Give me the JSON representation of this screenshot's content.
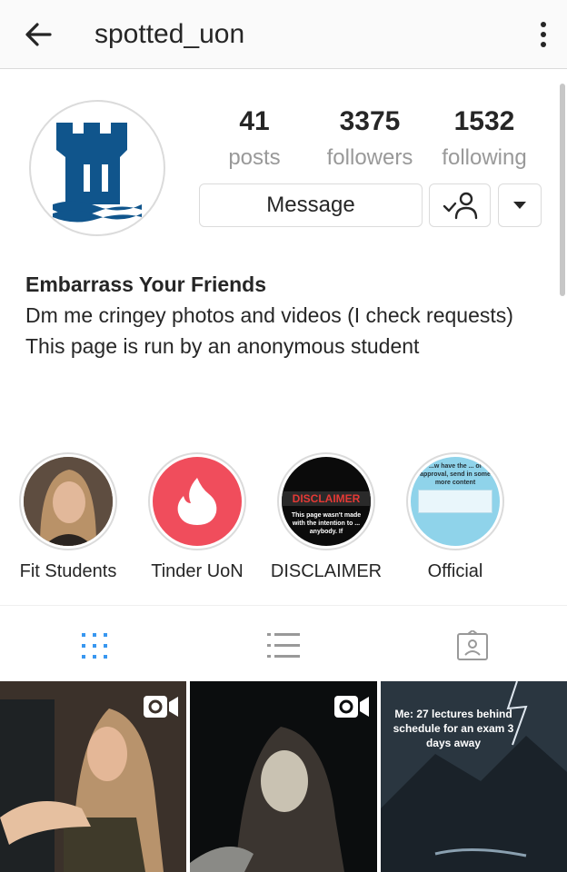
{
  "header": {
    "username": "spotted_uon"
  },
  "profile": {
    "stats": {
      "posts": {
        "value": "41",
        "label": "posts"
      },
      "followers": {
        "value": "3375",
        "label": "followers"
      },
      "following": {
        "value": "1532",
        "label": "following"
      }
    },
    "buttons": {
      "message": "Message"
    },
    "bio": {
      "name": "Embarrass Your Friends",
      "line1": "Dm me cringey photos and videos (I check requests)",
      "line2": "This page is run by an anonymous student"
    }
  },
  "highlights": [
    {
      "label": "Fit Students"
    },
    {
      "label": "Tinder UoN"
    },
    {
      "label": "DISCLAIMER",
      "thumb_title": "DISCLAIMER",
      "thumb_text": "This page wasn't made with the intention to ... anybody. If"
    },
    {
      "label": "Official",
      "thumb_text": "...w have the ... of approval, send in some more content"
    }
  ],
  "tabs": [
    {
      "icon": "grid-icon",
      "active": true
    },
    {
      "icon": "list-icon",
      "active": false
    },
    {
      "icon": "tagged-icon",
      "active": false
    }
  ],
  "posts": [
    {
      "type": "video"
    },
    {
      "type": "video"
    },
    {
      "type": "image",
      "caption": "Me: 27 lectures behind schedule for an exam 3 days away"
    }
  ],
  "colors": {
    "accent_blue": "#3897f0",
    "uon_blue": "#10558c",
    "tinder_red": "#f04d5c",
    "muted_text": "#999999",
    "border": "#dbdbdb"
  }
}
